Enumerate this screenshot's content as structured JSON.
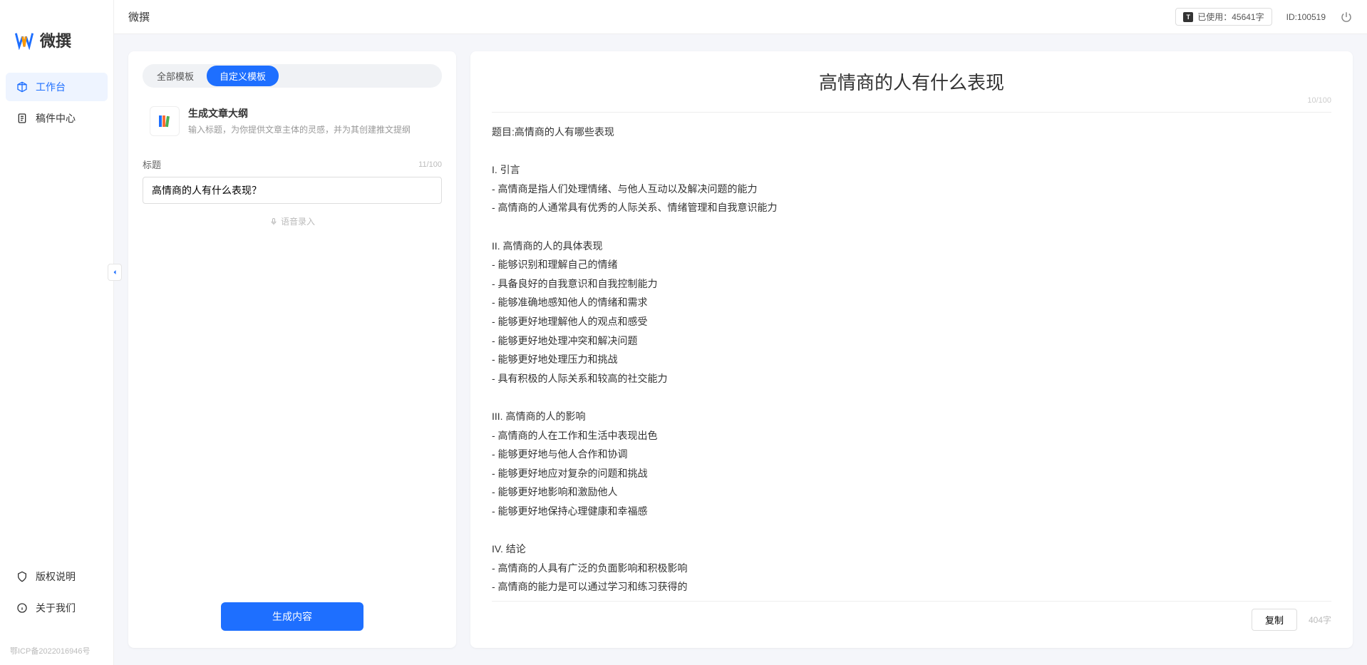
{
  "brand": {
    "name": "微撰"
  },
  "sidebar": {
    "nav": [
      {
        "label": "工作台",
        "active": true
      },
      {
        "label": "稿件中心",
        "active": false
      }
    ],
    "footer": [
      {
        "label": "版权说明"
      },
      {
        "label": "关于我们"
      }
    ],
    "icp": "鄂ICP备2022016946号"
  },
  "topbar": {
    "title": "微撰",
    "usage_label": "已使用：45641字",
    "user_id": "ID:100519"
  },
  "left_panel": {
    "tabs": [
      {
        "label": "全部模板",
        "active": false
      },
      {
        "label": "自定义模板",
        "active": true
      }
    ],
    "template": {
      "title": "生成文章大纲",
      "desc": "输入标题，为你提供文章主体的灵感，并为其创建推文提纲"
    },
    "field_label": "标题",
    "char_count": "11/100",
    "input_value": "高情商的人有什么表现？",
    "voice_hint": "语音录入",
    "generate_button": "生成内容"
  },
  "right_panel": {
    "title": "高情商的人有什么表现",
    "title_count": "10/100",
    "body": "题目:高情商的人有哪些表现\n\nI. 引言\n- 高情商是指人们处理情绪、与他人互动以及解决问题的能力\n- 高情商的人通常具有优秀的人际关系、情绪管理和自我意识能力\n\nII. 高情商的人的具体表现\n- 能够识别和理解自己的情绪\n- 具备良好的自我意识和自我控制能力\n- 能够准确地感知他人的情绪和需求\n- 能够更好地理解他人的观点和感受\n- 能够更好地处理冲突和解决问题\n- 能够更好地处理压力和挑战\n- 具有积极的人际关系和较高的社交能力\n\nIII. 高情商的人的影响\n- 高情商的人在工作和生活中表现出色\n- 能够更好地与他人合作和协调\n- 能够更好地应对复杂的问题和挑战\n- 能够更好地影响和激励他人\n- 能够更好地保持心理健康和幸福感\n\nIV. 结论\n- 高情商的人具有广泛的负面影响和积极影响\n- 高情商的能力是可以通过学习和练习获得的\n- 培养和提高高情商的能力对于个人的职业发展和生活质量至关重要。",
    "copy_button": "复制",
    "word_count": "404字"
  }
}
